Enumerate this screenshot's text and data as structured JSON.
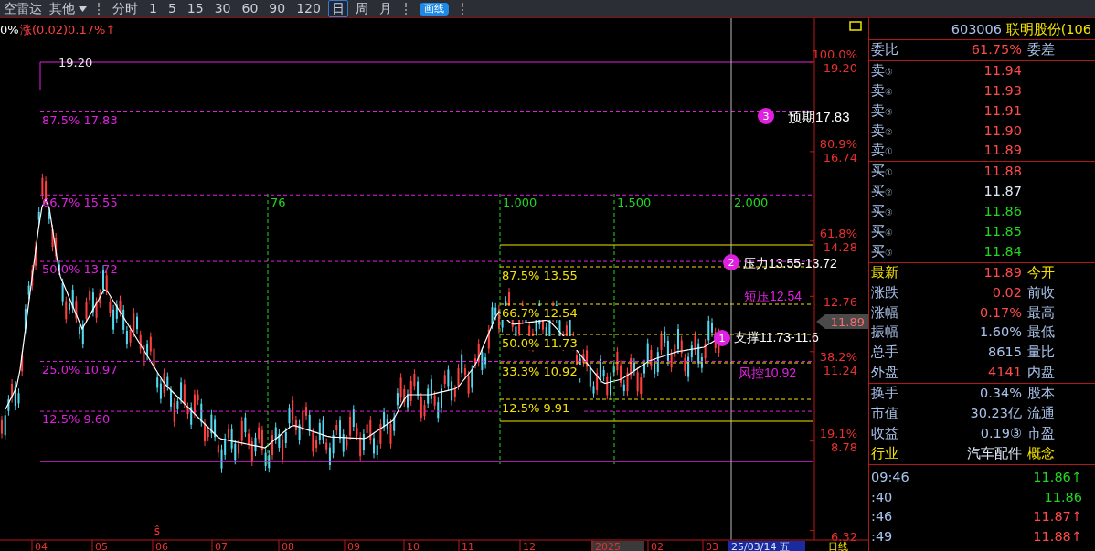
{
  "toolbar": {
    "left_label": "空雷达",
    "menu": "其他",
    "periods": [
      {
        "label": "分时",
        "selected": false
      },
      {
        "label": "1",
        "selected": false
      },
      {
        "label": "5",
        "selected": false
      },
      {
        "label": "15",
        "selected": false
      },
      {
        "label": "30",
        "selected": false
      },
      {
        "label": "60",
        "selected": false
      },
      {
        "label": "90",
        "selected": false
      },
      {
        "label": "120",
        "selected": false
      },
      {
        "label": "日",
        "selected": true
      },
      {
        "label": "周",
        "selected": false
      },
      {
        "label": "月",
        "selected": false
      }
    ],
    "draw_button": "画线"
  },
  "header": {
    "prefix": "0%",
    "change": "涨(0.02)0.17%↑"
  },
  "chart": {
    "top_price": "19.20",
    "fib_levels": [
      "87.5% 17.83",
      "66.7% 15.55",
      "50.0% 13.72",
      "25.0% 10.97",
      "12.5% 9.60"
    ],
    "time_marks": [
      "76",
      "1.000",
      "1.500",
      "2.000"
    ],
    "inner_levels": [
      "87.5% 13.55",
      "66.7% 12.54",
      "50.0% 11.73",
      "33.3% 10.92",
      "12.5% 9.91"
    ],
    "markers": [
      {
        "number": "3",
        "text": "预期17.83"
      },
      {
        "number": "2",
        "text": "压力13.55-13.72"
      },
      {
        "number": "1",
        "text": "支撑11.73-11.6"
      }
    ],
    "notes": [
      "短压12.54",
      "风控10.92"
    ],
    "price_axis": [
      {
        "pct": "100.0%",
        "price": "19.20"
      },
      {
        "pct": "80.9%",
        "price": "16.74"
      },
      {
        "pct": "61.8%",
        "price": "14.28"
      },
      {
        "price": "12.76"
      },
      {
        "pct": "38.2%",
        "price": "11.24"
      },
      {
        "pct": "19.1%",
        "price": "8.78"
      },
      {
        "price": "6.32"
      }
    ],
    "current_price": "11.89",
    "event_mark": "ŝ",
    "months": [
      "04",
      "05",
      "06",
      "07",
      "08",
      "09",
      "10",
      "11",
      "12",
      "2025",
      "02",
      "03"
    ],
    "cursor_date": "25/03/14 五",
    "period_label": "日线"
  },
  "quote": {
    "code": "603006",
    "name": "联明股份(106",
    "ratio": {
      "label": "委比",
      "value": "61.75%",
      "label2": "委差",
      "color": "#ff4a4a"
    },
    "asks": [
      {
        "label": "卖",
        "index": "⑤",
        "price": "11.94",
        "color": "#ff4a4a"
      },
      {
        "label": "卖",
        "index": "④",
        "price": "11.93",
        "color": "#ff4a4a"
      },
      {
        "label": "卖",
        "index": "③",
        "price": "11.91",
        "color": "#ff4a4a"
      },
      {
        "label": "卖",
        "index": "②",
        "price": "11.90",
        "color": "#ff4a4a"
      },
      {
        "label": "卖",
        "index": "①",
        "price": "11.89",
        "color": "#ff4a4a"
      }
    ],
    "bids": [
      {
        "label": "买",
        "index": "①",
        "price": "11.88",
        "color": "#ff4a4a"
      },
      {
        "label": "买",
        "index": "②",
        "price": "11.87",
        "color": "#dce6f5"
      },
      {
        "label": "买",
        "index": "③",
        "price": "11.86",
        "color": "#22d622"
      },
      {
        "label": "买",
        "index": "④",
        "price": "11.85",
        "color": "#22d622"
      },
      {
        "label": "买",
        "index": "⑤",
        "price": "11.84",
        "color": "#22d622"
      }
    ],
    "stats": [
      {
        "label": "最新",
        "value": "11.89",
        "label2": "今开",
        "color": "#ff4a4a",
        "highlight": true
      },
      {
        "label": "涨跌",
        "value": "0.02",
        "label2": "前收",
        "color": "#ff4a4a",
        "highlight": false
      },
      {
        "label": "涨幅",
        "value": "0.17%",
        "label2": "最高",
        "color": "#ff4a4a",
        "highlight": false
      },
      {
        "label": "振幅",
        "value": "1.60%",
        "label2": "最低",
        "color": "#a9c2ea",
        "highlight": false
      },
      {
        "label": "总手",
        "value": "8615",
        "label2": "量比",
        "color": "#a9c2ea",
        "highlight": false
      },
      {
        "label": "外盘",
        "value": "4141",
        "label2": "内盘",
        "color": "#ff4a4a",
        "highlight": false
      }
    ],
    "info": [
      {
        "label": "换手",
        "value": "0.34%",
        "label2": "股本",
        "color": "#a9c2ea",
        "highlight": false
      },
      {
        "label": "市值",
        "value": "30.23亿",
        "label2": "流通",
        "color": "#a9c2ea",
        "highlight": false
      },
      {
        "label": "收益",
        "value": "0.19③",
        "label2": "市盈",
        "color": "#a9c2ea",
        "highlight": false
      },
      {
        "label": "行业",
        "value": "汽车配件",
        "label2": "概念",
        "color": "#dce6f5",
        "highlight": true
      }
    ],
    "ticks": [
      {
        "time": "09:46",
        "price": "11.86↑",
        "color": "#22d622"
      },
      {
        "time": ":40",
        "price": "11.86",
        "color": "#22d622"
      },
      {
        "time": ":46",
        "price": "11.87↑",
        "color": "#ff4a4a"
      },
      {
        "time": ":49",
        "price": "11.88↑",
        "color": "#ff4a4a"
      }
    ]
  }
}
